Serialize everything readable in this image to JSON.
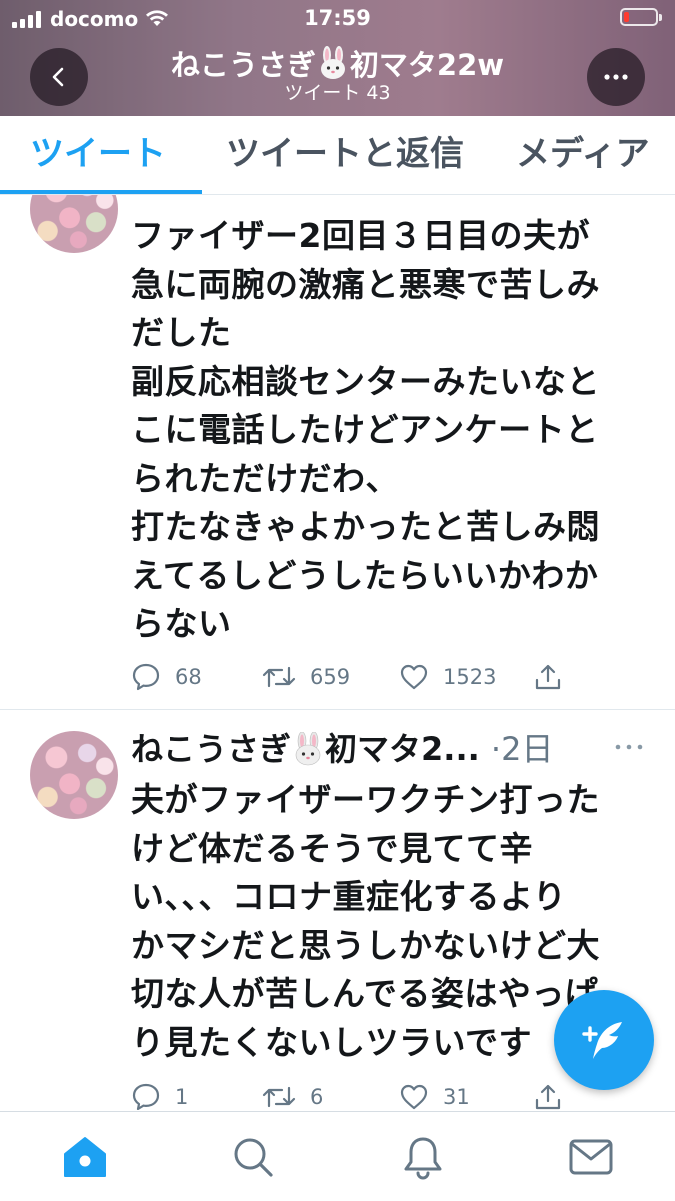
{
  "status_bar": {
    "carrier": "docomo",
    "time": "17:59"
  },
  "header": {
    "title": "ねこうさぎ🐰初マタ22w",
    "title_prefix": "ねこうさぎ",
    "title_suffix": "初マタ22w",
    "subtitle": "ツイート 43",
    "back_icon": "chevron-left-icon",
    "more_icon": "more-horizontal-icon"
  },
  "tabs": [
    {
      "label": "ツイート",
      "active": true
    },
    {
      "label": "ツイートと返信",
      "active": false
    },
    {
      "label": "メディア",
      "active": false
    }
  ],
  "tweets": [
    {
      "lines": [
        "ファイザー2回目３日目の夫が",
        "急に両腕の激痛と悪寒で苦しみ",
        "だした",
        "副反応相談センターみたいなと",
        "こに電話したけどアンケートと",
        "られただけだわ、",
        "打たなきゃよかったと苦しみ悶",
        "えてるしどうしたらいいかわか",
        "らない"
      ],
      "replies": "68",
      "retweets": "659",
      "likes": "1523"
    },
    {
      "author": "ねこうさぎ",
      "author_suffix": "初マタ2...",
      "time": "·2日",
      "lines": [
        "夫がファイザーワクチン打った",
        "けど体だるそうで見てて辛",
        "い、、、コロナ重症化するより",
        "かマシだと思うしかないけど大",
        "切な人が苦しんでる姿はやっぱ",
        "り見たくないしツラいです"
      ],
      "replies": "1",
      "retweets": "6",
      "likes": "31"
    }
  ],
  "colors": {
    "accent": "#1da1f2",
    "text": "#14171a",
    "muted": "#657786"
  },
  "bottom_nav": [
    "home-icon",
    "search-icon",
    "notifications-icon",
    "messages-icon"
  ]
}
